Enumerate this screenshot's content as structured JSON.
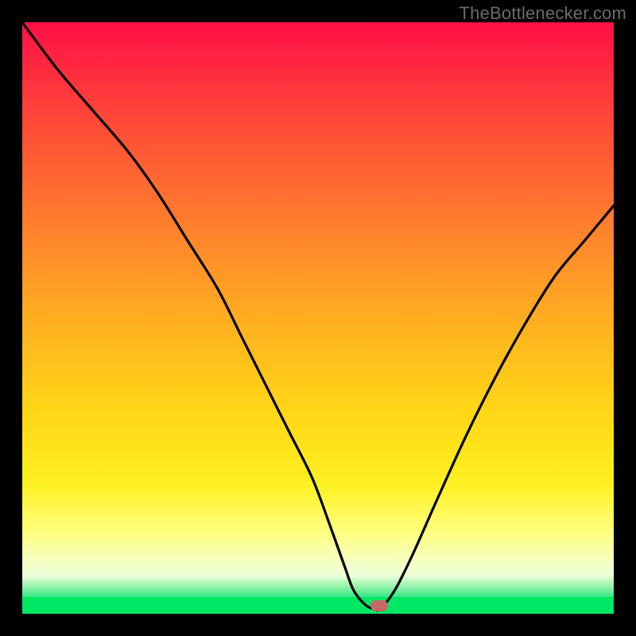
{
  "watermark": "TheBottlenecker.com",
  "chart_data": {
    "type": "line",
    "title": "",
    "xlabel": "",
    "ylabel": "",
    "xlim": [
      0,
      100
    ],
    "ylim": [
      0,
      100
    ],
    "series": [
      {
        "name": "bottleneck-curve",
        "x": [
          0,
          6,
          12,
          18,
          23,
          28,
          33,
          37,
          41,
          45,
          49,
          52,
          54.5,
          56,
          58,
          59.5,
          60.5,
          63,
          66,
          70,
          75,
          80,
          85,
          90,
          95,
          100
        ],
        "y": [
          100,
          92,
          85,
          78,
          71,
          63,
          55,
          47,
          39,
          31,
          23,
          15,
          8,
          4,
          1.5,
          0.8,
          0.8,
          4,
          10,
          19,
          30,
          40,
          49,
          57,
          63,
          69
        ]
      }
    ],
    "marker": {
      "x": 60.4,
      "y": 1.4
    },
    "gradient_stops": [
      {
        "pos": 0,
        "color": "#ff0f47"
      },
      {
        "pos": 0.22,
        "color": "#ff5a34"
      },
      {
        "pos": 0.52,
        "color": "#ffb31f"
      },
      {
        "pos": 0.78,
        "color": "#fff021"
      },
      {
        "pos": 0.91,
        "color": "#f6ffc1"
      },
      {
        "pos": 0.955,
        "color": "#8ff2a8"
      },
      {
        "pos": 0.972,
        "color": "#00e765"
      },
      {
        "pos": 1.0,
        "color": "#00e765"
      }
    ]
  }
}
